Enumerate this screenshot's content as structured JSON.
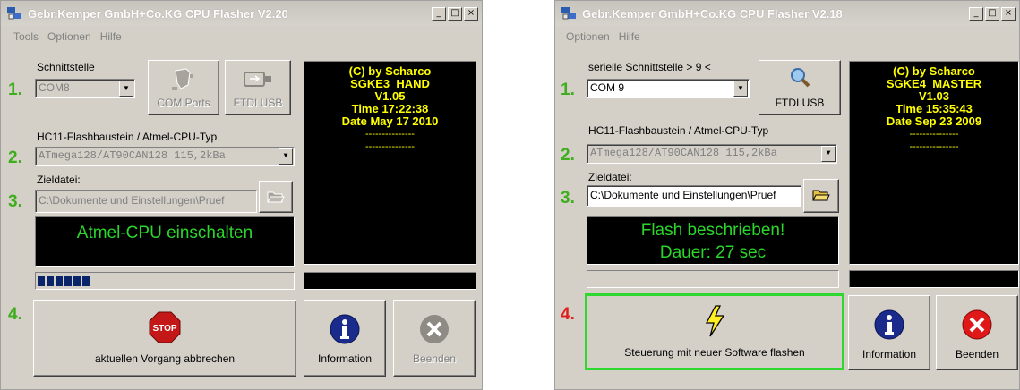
{
  "left": {
    "title": "Gebr.Kemper GmbH+Co.KG CPU Flasher V2.20",
    "menu": [
      "Tools",
      "Optionen",
      "Hilfe"
    ],
    "port_label": "Schnittstelle",
    "port_value": "COM8",
    "com_ports_label": "COM Ports",
    "ftdi_label": "FTDI USB",
    "cpu_label": "HC11-Flashbaustein / Atmel-CPU-Typ",
    "cpu_value": "ATmega128/AT90CAN128 115,2kBa",
    "target_label": "Zieldatei:",
    "target_value": "C:\\Dokumente und Einstellungen\\Pruef",
    "status_lines": [
      "Atmel-CPU einschalten"
    ],
    "info_lines": [
      "(C) by Scharco",
      "SGKE3_HAND",
      "V1.05",
      "Time 17:22:38",
      "Date May 17 2010",
      "---------------",
      "---------------"
    ],
    "progress_fraction": 0.2,
    "steps": [
      "1.",
      "2.",
      "3.",
      "4."
    ],
    "abort_label": "aktuellen Vorgang abbrechen",
    "stop_text": "STOP",
    "information_label": "Information",
    "quit_label": "Beenden"
  },
  "right": {
    "title": "Gebr.Kemper GmbH+Co.KG CPU Flasher V2.18",
    "menu": [
      "Optionen",
      "Hilfe"
    ],
    "port_label": "serielle Schnittstelle > 9 <",
    "port_value": "COM 9",
    "ftdi_label": "FTDI USB",
    "cpu_label": "HC11-Flashbaustein / Atmel-CPU-Typ",
    "cpu_value": "ATmega128/AT90CAN128 115,2kBa",
    "target_label": "Zieldatei:",
    "target_value": "C:\\Dokumente und Einstellungen\\Pruef",
    "status_lines": [
      "Flash beschrieben!",
      "Dauer: 27 sec"
    ],
    "info_lines": [
      "(C) by Scharco",
      "SGKE4_MASTER",
      "V1.03",
      "Time 15:35:43",
      "Date Sep 23 2009",
      "---------------",
      "---------------"
    ],
    "progress_fraction": 0,
    "steps": [
      "1.",
      "2.",
      "3.",
      "4."
    ],
    "flash_label": "Steuerung mit neuer Software flashen",
    "information_label": "Information",
    "quit_label": "Beenden"
  },
  "window_buttons": [
    "_",
    "□",
    "×"
  ]
}
